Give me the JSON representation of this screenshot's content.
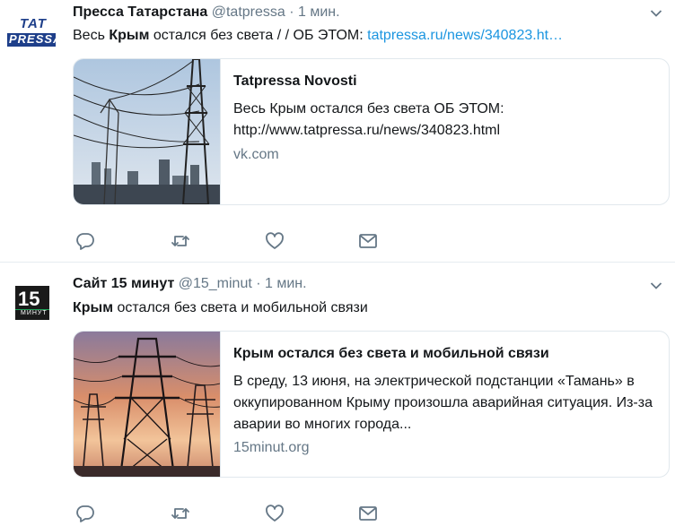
{
  "tweets": [
    {
      "author_name": "Пресса Татарстана",
      "handle": "@tatpressa",
      "time": "· 1 мин.",
      "avatar_top": "TAT",
      "avatar_bottom": "PRESSA",
      "text_before": "Весь ",
      "text_bold": "Крым",
      "text_after": " остался без света /  / ОБ ЭТОМ: ",
      "text_link": "tatpressa.ru/news/340823.ht…",
      "card": {
        "title": "Tatpressa Novosti",
        "description": "Весь Крым остался без света ОБ ЭТОМ: http://www.tatpressa.ru/news/340823.html",
        "domain": "vk.com"
      }
    },
    {
      "author_name": "Сайт 15 минут",
      "handle": "@15_minut",
      "time": "· 1 мин.",
      "avatar_num": "15",
      "avatar_word": "МИНУТ",
      "text_before": "",
      "text_bold": "Крым",
      "text_after": " остался без света и мобильной связи",
      "text_link": "",
      "card": {
        "title": "Крым остался без света и мобильной связи",
        "description": "В среду, 13 июня, на электрической подстанции «Тамань» в оккупированном Крыму произошла аварийная ситуация. Из-за аварии во многих города...",
        "domain": "15minut.org"
      }
    }
  ],
  "icons": [
    "reply-icon",
    "retweet-icon",
    "like-icon",
    "direct-message-icon",
    "chevron-down-icon"
  ],
  "colors": {
    "link": "#1b95e0",
    "muted": "#657786",
    "border": "#e1e8ed"
  }
}
